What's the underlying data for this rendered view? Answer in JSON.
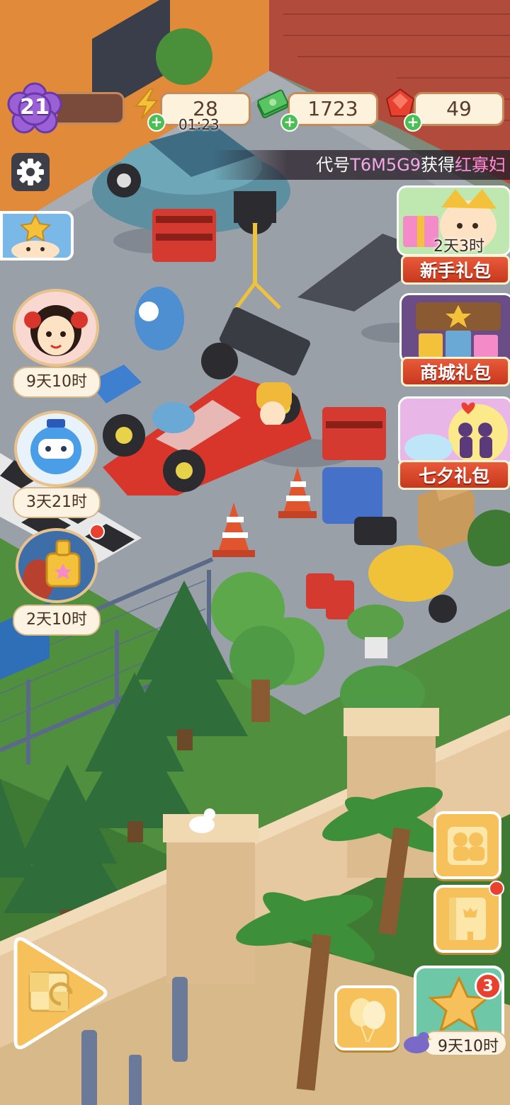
{
  "hud": {
    "level": "21",
    "energy": "28",
    "energy_timer": "01:23",
    "cash": "1723",
    "gems": "49",
    "plus": "+"
  },
  "ticker": {
    "prefix": "代号",
    "code": "T6M5G9",
    "middle": "获得",
    "item": "红寡妇"
  },
  "left_events": [
    {
      "name": "event-opera",
      "timer": "9天10时"
    },
    {
      "name": "event-robot",
      "timer": "3天21时"
    },
    {
      "name": "event-perfume",
      "timer": "2天10时"
    }
  ],
  "right_gifts": [
    {
      "name": "新手礼包",
      "timer": "2天3时"
    },
    {
      "name": "商城礼包"
    },
    {
      "name": "七夕礼包"
    }
  ],
  "bottom_right": {
    "star_badge": "3",
    "star_timer": "9天10时"
  },
  "colors": {
    "accent": "#f6c15a",
    "gift_red": "#d8462a",
    "level_purple": "#9b5fd6",
    "plus_green": "#4cbf54"
  }
}
